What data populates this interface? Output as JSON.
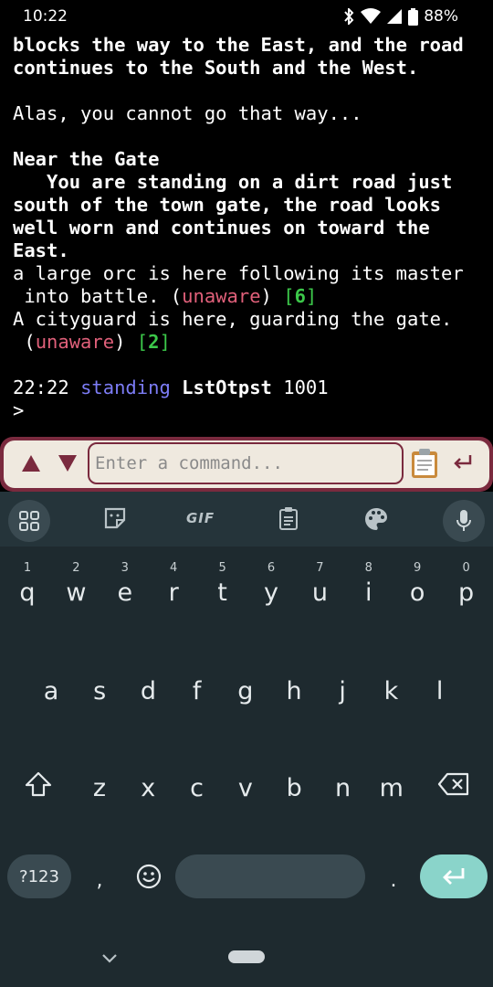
{
  "status_bar": {
    "time": "10:22",
    "battery": "88%"
  },
  "terminal": {
    "lines": [
      {
        "segments": [
          {
            "text": "blocks the way to the East, and the road",
            "style": "b"
          }
        ]
      },
      {
        "segments": [
          {
            "text": "continues to the South and the West.",
            "style": "b"
          }
        ]
      },
      {
        "segments": []
      },
      {
        "segments": [
          {
            "text": "Alas, you cannot go that way...",
            "style": ""
          }
        ]
      },
      {
        "segments": []
      },
      {
        "segments": [
          {
            "text": "Near the Gate",
            "style": "b"
          }
        ]
      },
      {
        "segments": [
          {
            "text": "   You are standing on a dirt road just",
            "style": "b"
          }
        ]
      },
      {
        "segments": [
          {
            "text": "south of the town gate, the road looks",
            "style": "b"
          }
        ]
      },
      {
        "segments": [
          {
            "text": "well worn and continues on toward the",
            "style": "b"
          }
        ]
      },
      {
        "segments": [
          {
            "text": "East.",
            "style": "b"
          }
        ]
      },
      {
        "segments": [
          {
            "text": "a large orc is here following its master",
            "style": ""
          }
        ]
      },
      {
        "segments": [
          {
            "text": " into battle. (",
            "style": ""
          },
          {
            "text": "unaware",
            "style": "pink"
          },
          {
            "text": ") ",
            "style": ""
          },
          {
            "text": "[",
            "style": "green"
          },
          {
            "text": "6",
            "style": "green b"
          },
          {
            "text": "]",
            "style": "green"
          }
        ]
      },
      {
        "segments": [
          {
            "text": "A cityguard is here, guarding the gate.",
            "style": ""
          }
        ]
      },
      {
        "segments": [
          {
            "text": " (",
            "style": ""
          },
          {
            "text": "unaware",
            "style": "pink"
          },
          {
            "text": ") ",
            "style": ""
          },
          {
            "text": "[",
            "style": "green"
          },
          {
            "text": "2",
            "style": "green b"
          },
          {
            "text": "]",
            "style": "green"
          }
        ]
      },
      {
        "segments": []
      },
      {
        "segments": [
          {
            "text": "22:22 ",
            "style": ""
          },
          {
            "text": "standing",
            "style": "blue"
          },
          {
            "text": " ",
            "style": ""
          },
          {
            "text": "LstOtpst",
            "style": "b"
          },
          {
            "text": " 1001",
            "style": ""
          }
        ]
      },
      {
        "segments": [
          {
            "text": ">",
            "style": ""
          }
        ]
      }
    ]
  },
  "command_bar": {
    "placeholder": "Enter a command...",
    "value": ""
  },
  "keyboard": {
    "row1": [
      {
        "label": "q",
        "hint": "1"
      },
      {
        "label": "w",
        "hint": "2"
      },
      {
        "label": "e",
        "hint": "3"
      },
      {
        "label": "r",
        "hint": "4"
      },
      {
        "label": "t",
        "hint": "5"
      },
      {
        "label": "y",
        "hint": "6"
      },
      {
        "label": "u",
        "hint": "7"
      },
      {
        "label": "i",
        "hint": "8"
      },
      {
        "label": "o",
        "hint": "9"
      },
      {
        "label": "p",
        "hint": "0"
      }
    ],
    "row2": [
      "a",
      "s",
      "d",
      "f",
      "g",
      "h",
      "j",
      "k",
      "l"
    ],
    "row3": [
      "z",
      "x",
      "c",
      "v",
      "b",
      "n",
      "m"
    ],
    "symbols_label": "?123",
    "comma_label": ",",
    "period_label": ".",
    "gif_label": "GIF"
  },
  "colors": {
    "accent": "#7a2a3e",
    "unaware": "#e0607a",
    "count": "#3cc84a",
    "posture": "#7c7cf5",
    "keyboard_bg": "#1e2a2f",
    "enter_key": "#8ad4ca"
  },
  "icons": {
    "status": [
      "bluetooth-icon",
      "wifi-icon",
      "signal-icon",
      "battery-icon"
    ],
    "command_bar": [
      "history-up-icon",
      "history-down-icon",
      "clipboard-icon",
      "enter-icon"
    ],
    "toolbar": [
      "apps-grid-icon",
      "sticker-icon",
      "gif-icon",
      "clipboard-icon",
      "palette-icon",
      "mic-icon"
    ]
  }
}
